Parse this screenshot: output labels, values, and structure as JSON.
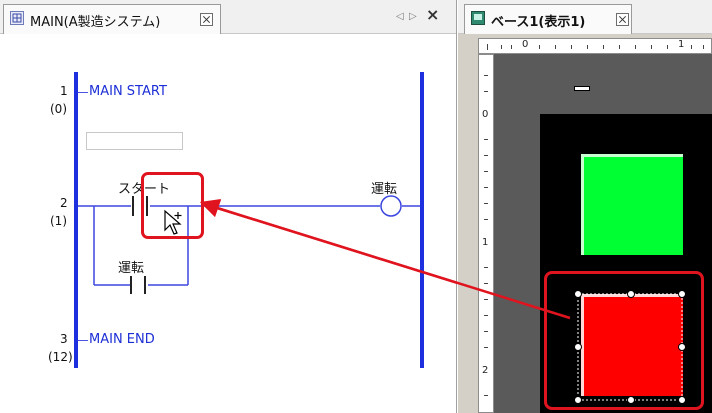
{
  "left_tab": {
    "title": "MAIN(A製造システム)"
  },
  "ladder": {
    "rungs": [
      {
        "number": "1",
        "step": "(0)",
        "label": "MAIN START"
      },
      {
        "number": "2",
        "step": "(1)"
      },
      {
        "number": "3",
        "step": "(12)",
        "label": "MAIN END"
      }
    ],
    "contact_start": "スタート",
    "contact_run": "運転",
    "coil_run": "運転"
  },
  "right_tab": {
    "title": "ベース1(表示1)"
  },
  "ruler": {
    "h_labels": [
      "0",
      "1"
    ],
    "v_labels": [
      "0",
      "1",
      "2"
    ]
  },
  "screen": {
    "green_lamp_color": "#00ff33",
    "red_switch_color": "#ff0000",
    "highlight_color": "#e0141e"
  }
}
